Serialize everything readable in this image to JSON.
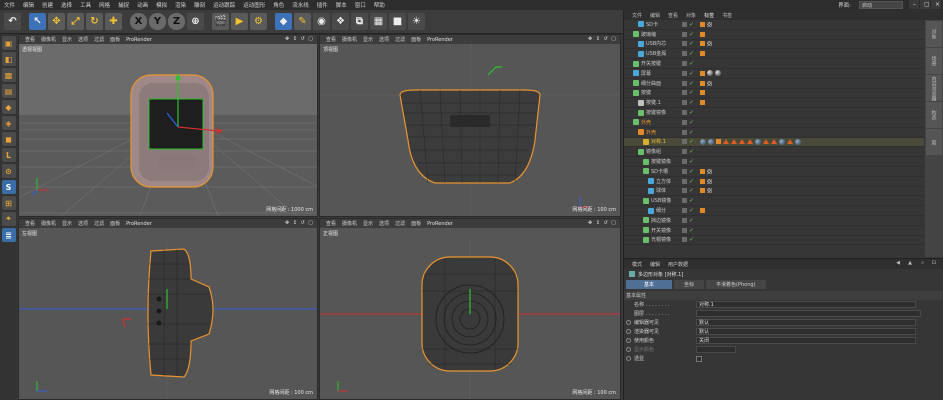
{
  "menubar": {
    "items": [
      "文件",
      "编辑",
      "创建",
      "选择",
      "工具",
      "网格",
      "捕捉",
      "动画",
      "模拟",
      "渲染",
      "雕刻",
      "运动跟踪",
      "运动图形",
      "角色",
      "流水线",
      "插件",
      "脚本",
      "窗口",
      "帮助"
    ],
    "layout_label": "界面:",
    "layout_value": "启动"
  },
  "toolbar": {
    "axis_x": "X",
    "axis_y": "Y",
    "axis_z": "Z"
  },
  "viewports": {
    "menu": [
      "查看",
      "摄像机",
      "显示",
      "选项",
      "过滤",
      "面板"
    ],
    "prorender": "ProRender",
    "controls": "✥ ↕ ↺ ▢",
    "perspective": {
      "name": "透视视图",
      "scale": "网格间距 : 1000 cm"
    },
    "top": {
      "name": "顶视图",
      "scale": "网格间距 : 100 cm"
    },
    "left": {
      "name": "左视图",
      "scale": "网格间距 : 100 cm"
    },
    "front": {
      "name": "正视图",
      "scale": "网格间距 : 100 cm"
    }
  },
  "object_manager": {
    "tabs": [
      "文件",
      "编辑",
      "查看",
      "对象",
      "标签",
      "书签"
    ],
    "rows": [
      {
        "name": "SD卡",
        "indent": 2
      },
      {
        "name": "玻璃缩",
        "indent": 1
      },
      {
        "name": "USB内芯",
        "indent": 2
      },
      {
        "name": "USB金属",
        "indent": 2
      },
      {
        "name": "开关按键",
        "indent": 1
      },
      {
        "name": "屏幕",
        "indent": 1
      },
      {
        "name": "细分曲面",
        "indent": 1
      },
      {
        "name": "按键",
        "indent": 1
      },
      {
        "name": "按键.1",
        "indent": 2
      },
      {
        "name": "按键镜像",
        "indent": 2
      },
      {
        "name": "外壳",
        "indent": 1
      },
      {
        "name": "外壳",
        "indent": 2
      },
      {
        "name": "对称.1",
        "indent": 3
      },
      {
        "name": "镜像组",
        "indent": 2
      },
      {
        "name": "按键镜像",
        "indent": 3
      },
      {
        "name": "SD卡槽",
        "indent": 3
      },
      {
        "name": "立方体",
        "indent": 4
      },
      {
        "name": "球体",
        "indent": 4
      },
      {
        "name": "USB镜像",
        "indent": 3
      },
      {
        "name": "细分",
        "indent": 4
      },
      {
        "name": "挡边镜像",
        "indent": 3
      },
      {
        "name": "开关镜像",
        "indent": 3
      },
      {
        "name": "光帽镜像",
        "indent": 3
      }
    ],
    "side_tabs": [
      "对象",
      "场景",
      "内容浏览器",
      "构造",
      "层"
    ]
  },
  "attributes": {
    "tabs": [
      "模式",
      "编辑",
      "用户数据"
    ],
    "title": "多边形对象 [对称.1]",
    "subtabs": [
      "基本",
      "坐标",
      "平滑着色(Phong)"
    ],
    "section": "基本属性",
    "fields": [
      {
        "label": "名称 . . . . . . . .",
        "value": "对称.1"
      },
      {
        "label": "图层 . . . . . . . .",
        "value": ""
      },
      {
        "label": "编辑器可见",
        "value": "默认"
      },
      {
        "label": "渲染器可见",
        "value": "默认"
      },
      {
        "label": "使用颜色",
        "value": "关闭"
      },
      {
        "label": "显示颜色",
        "value": ""
      },
      {
        "label": "透显",
        "value": ""
      }
    ]
  },
  "colors": {
    "accent": "#f2c230",
    "selection_orange": "#e8952f",
    "axis_red": "#d03030",
    "axis_green": "#30c030",
    "axis_blue": "#3060e0"
  }
}
